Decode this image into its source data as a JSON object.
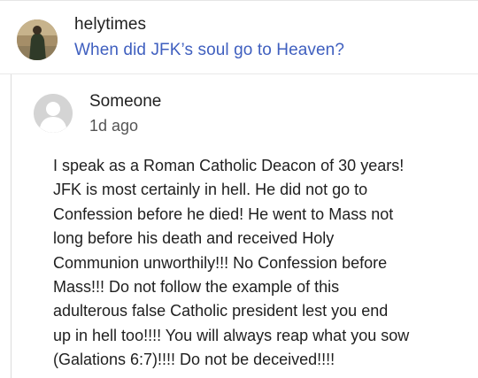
{
  "question": {
    "username": "helytimes",
    "title": "When did JFK’s soul go to Heaven?"
  },
  "comment": {
    "author": "Someone",
    "time": "1d ago",
    "lines": [
      "I speak as a Roman Catholic Deacon of 30 years!",
      "JFK is most certainly in hell. He did not go to",
      "Confession before he died! He went to Mass not",
      "long before his death and received Holy",
      "Communion unworthily!!! No Confession before",
      "Mass!!! Do not follow the example of this",
      "adulterous false Catholic president lest you end",
      "up in hell too!!!! You will always reap what you sow",
      "(Galations 6:7)!!!! Do not be deceived!!!!"
    ]
  },
  "colors": {
    "link": "#3f5fbf",
    "text": "#1f1f1f",
    "muted": "#555555"
  },
  "icons": {
    "question_avatar": "user-photo-avatar",
    "comment_avatar": "default-user-avatar-icon"
  }
}
